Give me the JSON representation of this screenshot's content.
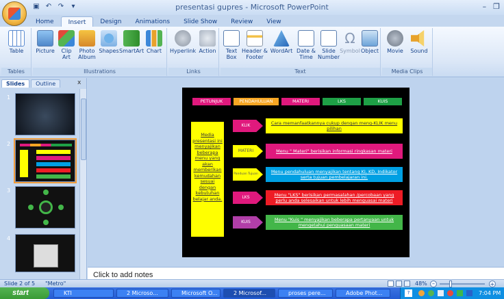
{
  "window": {
    "title": "presentasi gupres - Microsoft PowerPoint",
    "minimize_glyph": "–",
    "maximize_glyph": "❐"
  },
  "quick_access": {
    "icons": [
      "save-icon",
      "undo-icon",
      "redo-icon"
    ]
  },
  "tabs": [
    {
      "label": "Home"
    },
    {
      "label": "Insert",
      "active": true
    },
    {
      "label": "Design"
    },
    {
      "label": "Animations"
    },
    {
      "label": "Slide Show"
    },
    {
      "label": "Review"
    },
    {
      "label": "View"
    }
  ],
  "ribbon": {
    "groups": {
      "tables": "Tables",
      "illustrations": "Illustrations",
      "links": "Links",
      "text": "Text",
      "media": "Media Clips"
    },
    "buttons": {
      "table": "Table",
      "picture": "Picture",
      "clip_art": "Clip Art",
      "photo_album": "Photo Album",
      "shapes": "Shapes",
      "smartart": "SmartArt",
      "chart": "Chart",
      "hyperlink": "Hyperlink",
      "action": "Action",
      "text_box": "Text Box",
      "header_footer": "Header & Footer",
      "wordart": "WordArt",
      "date_time": "Date & Time",
      "slide_number": "Slide Number",
      "symbol": "Symbol",
      "object": "Object",
      "movie": "Movie",
      "sound": "Sound"
    }
  },
  "slides_panel": {
    "tabs": [
      "Slides",
      "Outline"
    ],
    "close": "x",
    "numbers": [
      "1",
      "2",
      "3",
      "4"
    ]
  },
  "slide": {
    "menu": [
      "PETUNJUK",
      "PENDAHULUAN",
      "MATERI",
      "LKS",
      "KUIS"
    ],
    "menu_colors": [
      "#e0197d",
      "#f7a623",
      "#e0197d",
      "#1ea046",
      "#1ea046"
    ],
    "left_text": "Media presentasi ini menyajikan beberapa menu yang akan memberikan kemudahan sesuai dengan kebutuhan belajar anda.",
    "rows": [
      {
        "arrow": "KLIK",
        "arrow_color": "#e0197d",
        "text": "Cara memanfaatkannya cukup dengan meng-KLIK menu pilihan",
        "box_color": "#ffff00",
        "text_color": "#333333"
      },
      {
        "arrow": "MATERI",
        "arrow_color": "#ffff00",
        "text": "Menu \" Materi\" berisikan informasi ringkasan materi",
        "box_color": "#e0197d",
        "text_color": "#ffffff"
      },
      {
        "arrow": "Panduan Tujuan",
        "arrow_color": "#ffff00",
        "text": "Menu pendahuluan menyajikan tentang KI, KD, Indikator serta tujuan pembelajaran ini.",
        "box_color": "#00a0e3",
        "text_color": "#ffffff"
      },
      {
        "arrow": "LKS",
        "arrow_color": "#e0197d",
        "text": "Menu \"LKS\" berisikan permasalahan /percobaan yang perlu anda selesaikan untuk lebih menguasai materi",
        "box_color": "#ee1c25",
        "text_color": "#ffffff"
      },
      {
        "arrow": "KUIS",
        "arrow_color": "#b13ea8",
        "text": "Menu \"Kuis \" menyajikan beberapa pertanyaan untuk mengetahui penguasaan materi",
        "box_color": "#43b649",
        "text_color": "#ffffff"
      }
    ]
  },
  "notes": {
    "placeholder": "Click to add notes"
  },
  "status": {
    "slide_of": "Slide 2 of 5",
    "theme": "\"Metro\"",
    "zoom": "48%"
  },
  "taskbar": {
    "start": "start",
    "tasks": [
      "KTI",
      "2 Microso...",
      "Microsoft O...",
      "2 Microsof...",
      "proses pere...",
      "Adobe Phot..."
    ],
    "clock": "7:04 PM"
  }
}
